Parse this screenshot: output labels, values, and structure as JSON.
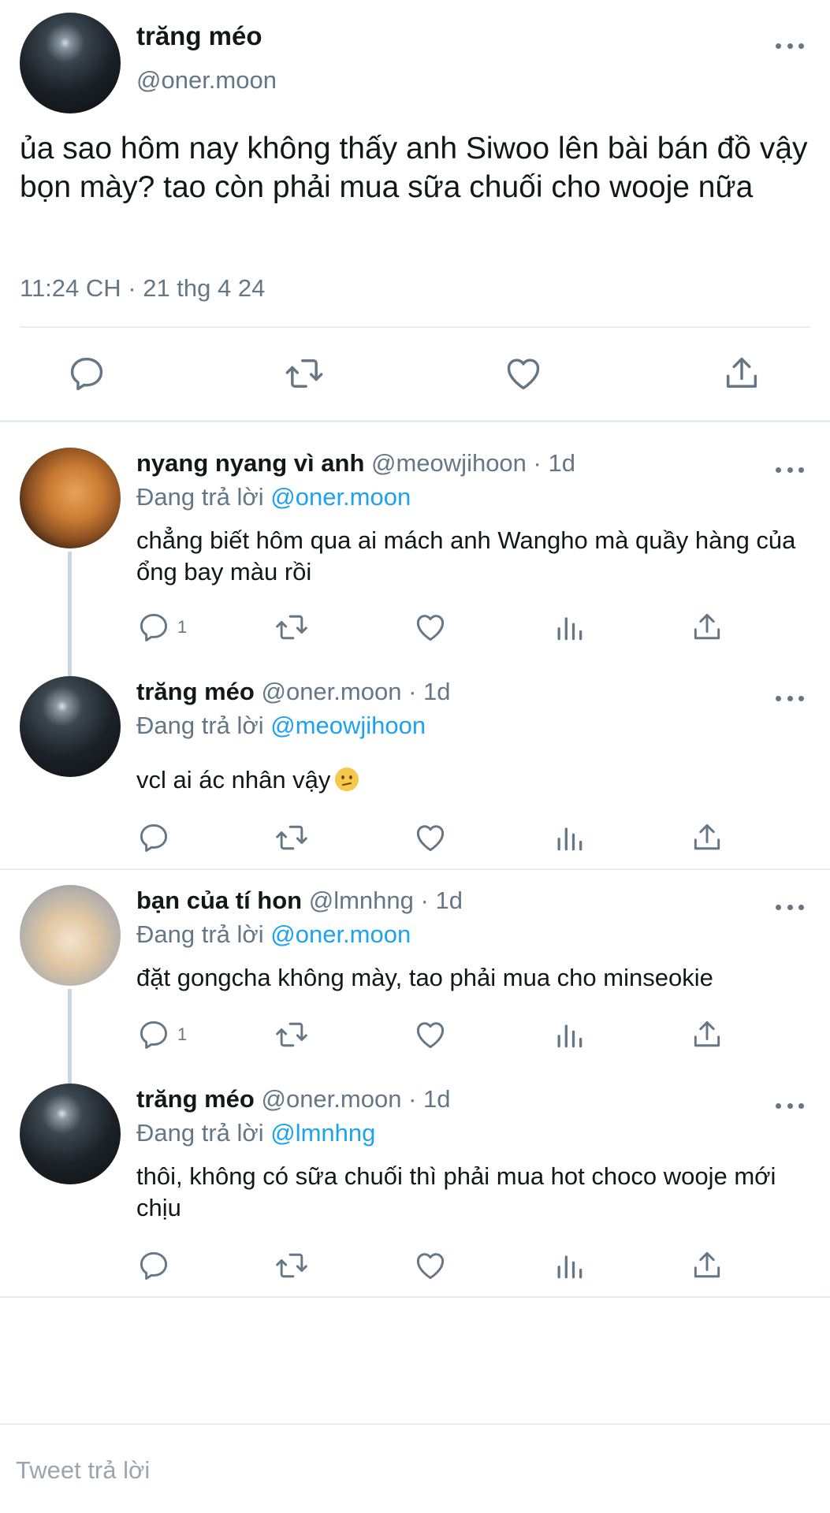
{
  "main_tweet": {
    "name": "trăng méo",
    "handle": "@oner.moon",
    "text": "ủa sao hôm nay không thấy anh Siwoo lên bài bán đồ vậy bọn mày? tao còn phải mua sữa chuối cho wooje nữa",
    "meta": "11:24 CH · 21 thg 4 24",
    "more_icon": "more-horizontal-icon",
    "actions": [
      "reply-icon",
      "retweet-icon",
      "like-icon",
      "share-icon"
    ]
  },
  "replies": [
    {
      "name": "nyang nyang vì anh",
      "handle": "@meowjihoon",
      "date": "· 1d",
      "replying_prefix": "Đang trả lời",
      "replying_to": "@oner.moon",
      "text": "chẳng biết hôm qua ai mách anh Wangho mà quầy hàng của ổng bay màu rồi",
      "reply_count": "1"
    },
    {
      "name": "trăng méo",
      "handle": "@oner.moon",
      "date": "· 1d",
      "replying_prefix": "Đang trả lời",
      "replying_to": "@meowjihoon",
      "text": "vcl ai ác nhân vậy",
      "emoji": "confused-face",
      "reply_count": ""
    },
    {
      "name": "bạn của tí hon",
      "handle": "@lmnhng",
      "date": "· 1d",
      "replying_prefix": "Đang trả lời",
      "replying_to": "@oner.moon",
      "text": "đặt gongcha không mày, tao phải mua cho minseokie",
      "reply_count": "1"
    },
    {
      "name": "trăng méo",
      "handle": "@oner.moon",
      "date": "· 1d",
      "replying_prefix": "Đang trả lời",
      "replying_to": "@lmnhng",
      "text": "thôi, không có sữa chuối thì phải mua hot choco wooje mới chịu",
      "reply_count": ""
    }
  ],
  "composer": {
    "placeholder": "Tweet trả lời"
  },
  "colors": {
    "text": "#14171a",
    "secondary": "#657786",
    "link": "#1da1f2",
    "divider": "#e6ecf0"
  }
}
